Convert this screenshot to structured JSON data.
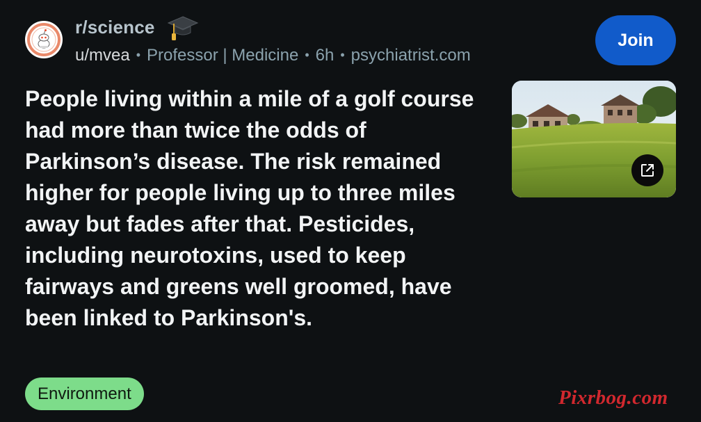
{
  "post": {
    "subreddit": "r/science",
    "author": "u/mvea",
    "author_flair": "Professor | Medicine",
    "age": "6h",
    "domain": "psychiatrist.com",
    "join_label": "Join",
    "title": "People living within a mile of a golf course had more than twice the odds of Parkinson’s disease. The risk remained higher for people living up to three miles away but fades after that. Pesticides, including neurotoxins, used to keep fairways and greens well groomed, have been linked to Parkinson's.",
    "post_flair": "Environment",
    "separator": "•"
  },
  "watermark": "Pixrbog.com",
  "icons": {
    "subreddit_avatar": "reddit-science-icon",
    "achievement": "graduation-cap-icon",
    "thumbnail": "golf-course-thumbnail",
    "external": "external-link-icon"
  },
  "colors": {
    "background": "#0e1113",
    "join_button": "#115bca",
    "flair": "#7ddc8a",
    "watermark": "#d1282e"
  }
}
